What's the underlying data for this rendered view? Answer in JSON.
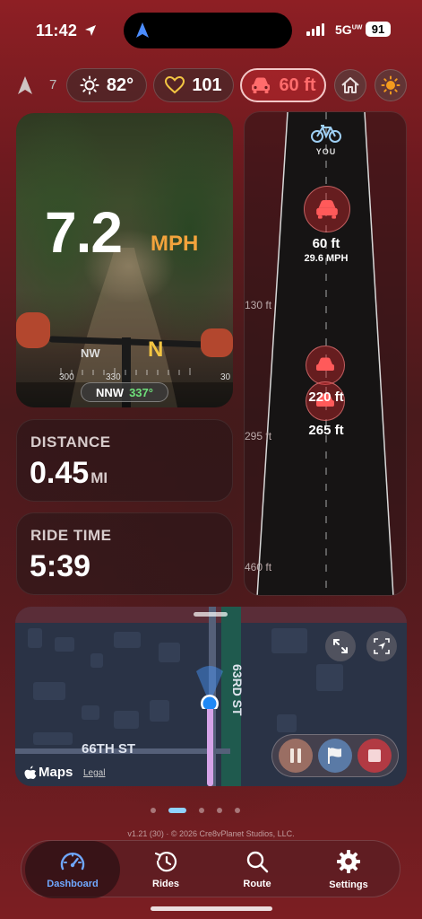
{
  "status": {
    "time": "11:42",
    "network": "5G",
    "network_sup": "UW",
    "battery": "91"
  },
  "top": {
    "location_count": "7",
    "temperature": "82°",
    "heart_rate": "101",
    "nearest_car": "60 ft"
  },
  "speed": {
    "value": "7.2",
    "unit": "MPH"
  },
  "compass": {
    "left_label": "NW",
    "center_label": "N",
    "ticks": [
      "300",
      "330",
      "30"
    ],
    "heading_dir": "NNW",
    "heading_deg": "337°"
  },
  "distance": {
    "label": "DISTANCE",
    "value": "0.45",
    "unit": "MI"
  },
  "ride_time": {
    "label": "RIDE TIME",
    "value": "5:39"
  },
  "radar": {
    "you_label": "YOU",
    "distance_marks": [
      "130 ft",
      "295 ft",
      "460 ft"
    ],
    "cars": [
      {
        "distance": "60 ft",
        "speed": "29.6 MPH"
      },
      {
        "distance": "220 ft"
      },
      {
        "distance": "265 ft"
      }
    ]
  },
  "map": {
    "street_vertical": "63RD ST",
    "street_horizontal": "66TH ST",
    "brand": "Maps",
    "legal": "Legal"
  },
  "footer": {
    "version": "v1.21 (30) · © 2026 Cre8vPlanet Studios, LLC."
  },
  "tabs": [
    {
      "label": "Dashboard",
      "active": true
    },
    {
      "label": "Rides"
    },
    {
      "label": "Route"
    },
    {
      "label": "Settings"
    }
  ],
  "colors": {
    "accent": "#6fa8ff",
    "alert": "#ff6c6c",
    "speed_unit": "#f3a33c",
    "compass_n": "#f3c542",
    "heading_green": "#6ee07a"
  }
}
